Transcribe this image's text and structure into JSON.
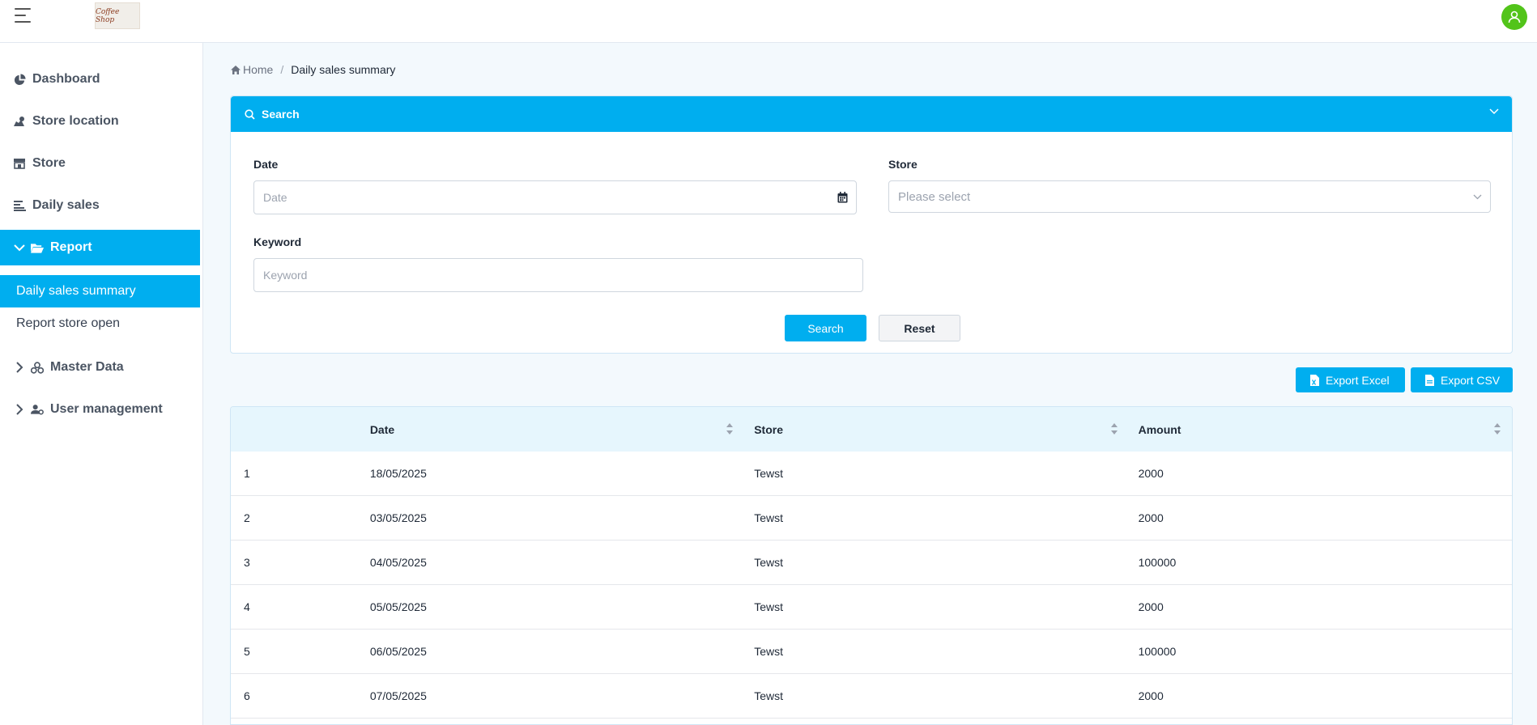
{
  "header": {
    "logo_text": "Coffee Shop",
    "menu_icon": "hamburger-icon",
    "avatar_icon": "user-icon"
  },
  "sidebar": {
    "items": [
      {
        "label": "Dashboard",
        "icon": "pie-chart-icon"
      },
      {
        "label": "Store location",
        "icon": "map-marker-icon"
      },
      {
        "label": "Store",
        "icon": "shop-icon"
      },
      {
        "label": "Daily sales",
        "icon": "list-icon"
      },
      {
        "label": "Report",
        "icon": "folder-open-icon",
        "expanded": true,
        "active": true
      },
      {
        "label": "Master Data",
        "icon": "cubes-icon",
        "expanded": false
      },
      {
        "label": "User management",
        "icon": "user-cog-icon",
        "expanded": false
      }
    ],
    "report_children": [
      {
        "label": "Daily sales summary",
        "active": true
      },
      {
        "label": "Report store open",
        "active": false
      }
    ]
  },
  "breadcrumb": {
    "home": "Home",
    "current": "Daily sales summary"
  },
  "search_panel": {
    "title": "Search",
    "date_label": "Date",
    "date_placeholder": "Date",
    "store_label": "Store",
    "store_placeholder": "Please select",
    "keyword_label": "Keyword",
    "keyword_placeholder": "Keyword",
    "search_button": "Search",
    "reset_button": "Reset"
  },
  "export": {
    "excel_label": "Export Excel",
    "csv_label": "Export CSV"
  },
  "table": {
    "columns": [
      "",
      "Date",
      "Store",
      "Amount"
    ],
    "rows": [
      {
        "no": "1",
        "date": "18/05/2025",
        "store": "Tewst",
        "amount": "2000"
      },
      {
        "no": "2",
        "date": "03/05/2025",
        "store": "Tewst",
        "amount": "2000"
      },
      {
        "no": "3",
        "date": "04/05/2025",
        "store": "Tewst",
        "amount": "100000"
      },
      {
        "no": "4",
        "date": "05/05/2025",
        "store": "Tewst",
        "amount": "2000"
      },
      {
        "no": "5",
        "date": "06/05/2025",
        "store": "Tewst",
        "amount": "100000"
      },
      {
        "no": "6",
        "date": "07/05/2025",
        "store": "Tewst",
        "amount": "2000"
      }
    ]
  },
  "colors": {
    "primary": "#00aeef",
    "avatar": "#52c41a",
    "table_header": "#e6f6fd",
    "page_bg": "#f3f9fd"
  }
}
